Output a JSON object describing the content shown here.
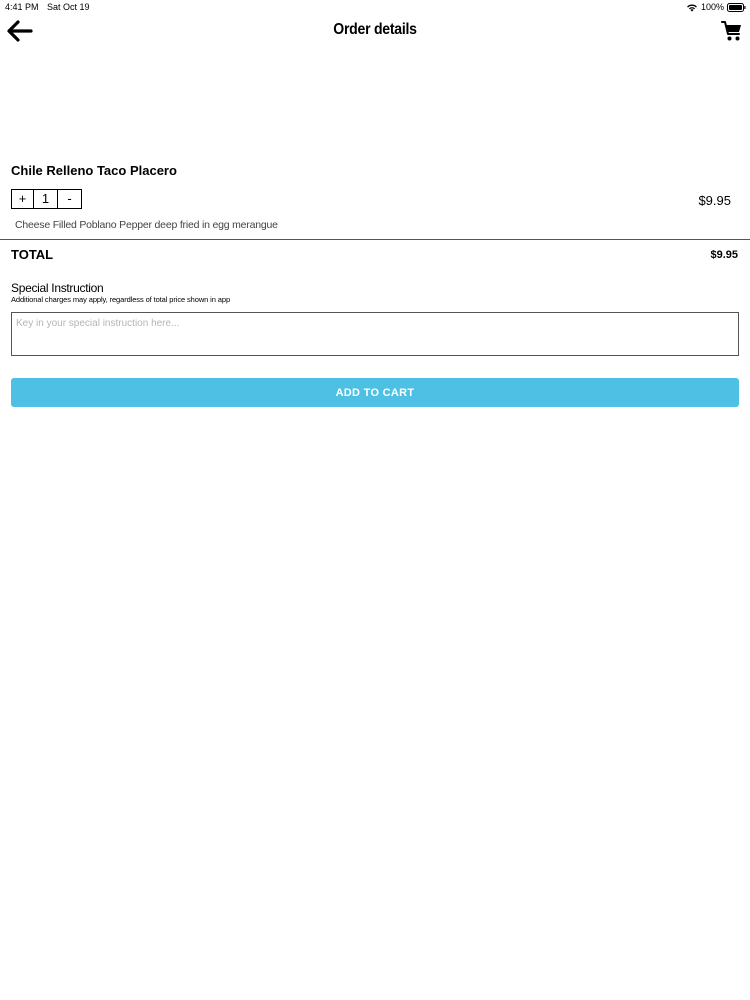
{
  "status_bar": {
    "time": "4:41 PM",
    "date": "Sat Oct 19",
    "battery": "100%"
  },
  "nav": {
    "title": "Order details",
    "back_icon": "back-arrow-icon",
    "cart_icon": "shopping-cart-icon"
  },
  "item": {
    "name": "Chile Relleno Taco Placero",
    "quantity": "1",
    "increment_label": "+",
    "decrement_label": "-",
    "price": "$9.95",
    "description": "Cheese Filled Poblano Pepper deep fried in egg merangue"
  },
  "total": {
    "label": "TOTAL",
    "value": "$9.95"
  },
  "special_instruction": {
    "title": "Special Instruction",
    "note": "Additional charges may apply, regardless of total price shown in app",
    "placeholder": "Key in your special instruction here...",
    "value": ""
  },
  "actions": {
    "add_to_cart_label": "ADD TO CART"
  },
  "colors": {
    "accent": "#4dc0e4",
    "divider": "#555555",
    "placeholder": "#b5b5b5"
  }
}
